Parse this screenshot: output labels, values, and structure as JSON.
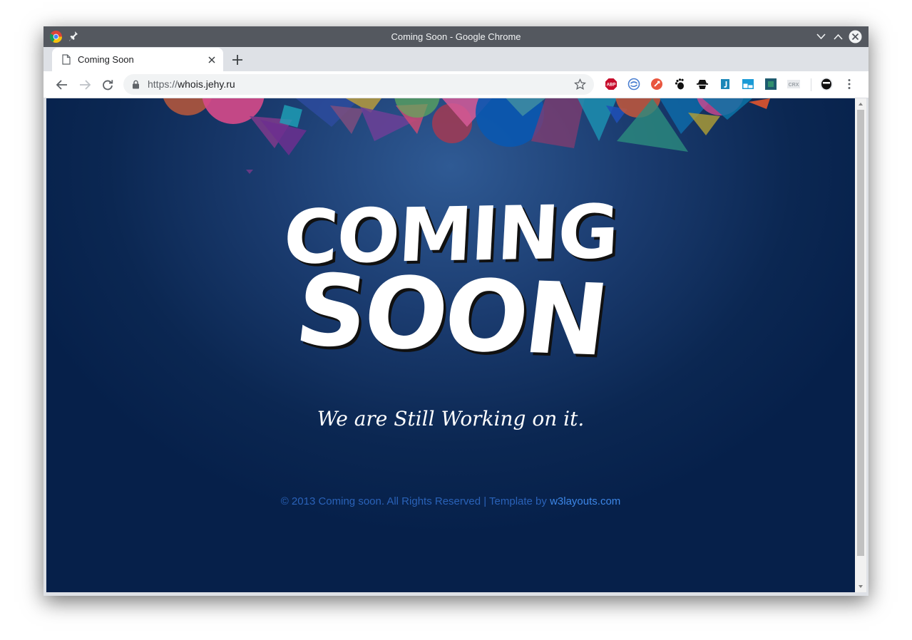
{
  "window": {
    "title": "Coming Soon - Google Chrome"
  },
  "tabs": [
    {
      "title": "Coming Soon",
      "active": true
    }
  ],
  "toolbar": {
    "url_scheme": "https://",
    "url_host": "whois.jehy.ru",
    "extensions": [
      "adblock-plus-icon",
      "sync-icon",
      "rocket-icon",
      "gnome-foot-icon",
      "spy-icon",
      "j-icon",
      "window-split-icon",
      "pixel-icon",
      "crx-icon",
      "avatar-icon"
    ]
  },
  "page": {
    "headline_line1": "COMING",
    "headline_line2": "SOON",
    "subtitle": "We are Still Working on it.",
    "footer_text": "© 2013 Coming soon. All Rights Reserved | Template by ",
    "footer_link": "w3layouts.com"
  },
  "colors": {
    "titlebar": "#54585f",
    "background_dark": "#06204a",
    "background_light": "#2f5a94",
    "footer_text": "#2a62b8",
    "footer_link": "#3d86e6"
  }
}
